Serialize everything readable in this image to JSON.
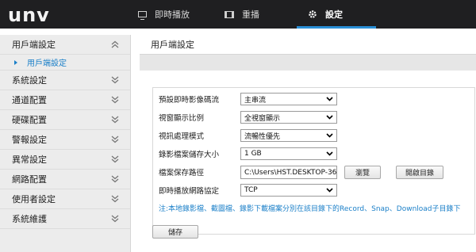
{
  "app": {
    "logo": "unv"
  },
  "topnav": {
    "items": [
      {
        "label": "即時播放",
        "icon": "monitor-icon"
      },
      {
        "label": "重播",
        "icon": "film-icon"
      },
      {
        "label": "設定",
        "icon": "gear-icon",
        "active": true
      }
    ]
  },
  "sidebar": {
    "items": [
      {
        "label": "用戶端設定",
        "expanded": true,
        "children": [
          {
            "label": "用戶端設定",
            "active": true
          }
        ]
      },
      {
        "label": "系統設定"
      },
      {
        "label": "通道配置"
      },
      {
        "label": "硬碟配置"
      },
      {
        "label": "警報設定"
      },
      {
        "label": "異常設定"
      },
      {
        "label": "網路配置"
      },
      {
        "label": "使用者設定"
      },
      {
        "label": "系統維護"
      }
    ]
  },
  "main": {
    "title": "用戶端設定",
    "fields": [
      {
        "label": "預設即時影像碼流",
        "value": "主串流"
      },
      {
        "label": "視窗顯示比例",
        "value": "全視窗顯示"
      },
      {
        "label": "視訊處理模式",
        "value": "流暢性優先"
      },
      {
        "label": "錄影檔案儲存大小",
        "value": "1 GB"
      },
      {
        "label": "檔案保存路徑",
        "value": "C:\\Users\\HST.DESKTOP-36"
      },
      {
        "label": "即時播放網路協定",
        "value": "TCP"
      }
    ],
    "browse_label": "瀏覽",
    "open_dir_label": "開啟目錄",
    "note": "注:本地錄影檔、截圖檔、錄影下載檔案分別在該目錄下的Record、Snap、Download子目錄下",
    "save_label": "儲存"
  },
  "colors": {
    "accent": "#2a8fd6",
    "topbar": "#1f1f21",
    "sidebar_bg": "#ececec",
    "link": "#1a7fc8"
  }
}
